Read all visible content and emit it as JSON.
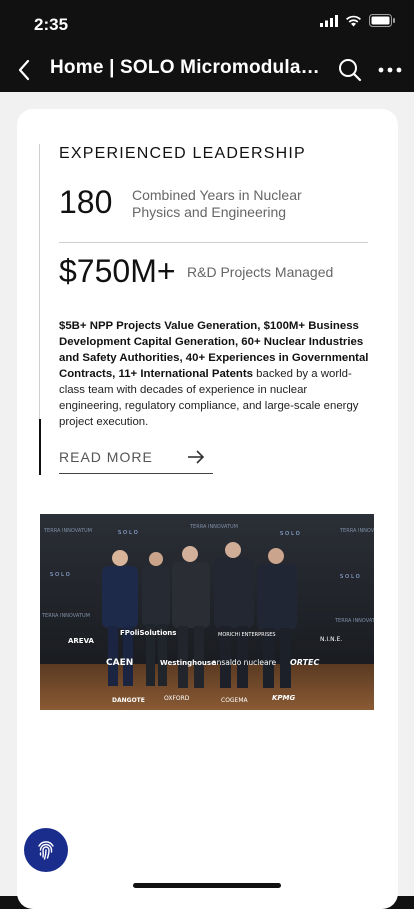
{
  "status_bar": {
    "time": "2:35",
    "icons": [
      "cellular-signal-icon",
      "wifi-icon",
      "battery-icon"
    ]
  },
  "browser": {
    "title": "Home | SOLO Micromodular...",
    "icons": [
      "back-icon",
      "search-icon",
      "more-icon"
    ]
  },
  "section": {
    "heading": "EXPERIENCED LEADERSHIP",
    "stats": [
      {
        "value": "180",
        "label": "Combined Years in Nuclear Physics and Engineering"
      },
      {
        "value": "$750M+",
        "label": "R&D Projects Managed"
      }
    ],
    "body_bold": "$5B+ NPP Projects Value Generation, $100M+ Business Development Capital Generation, 60+ Nuclear Industries and Safety Authorities, 40+ Experiences in Governmental Contracts, 11+ International Patents",
    "body_regular": " backed by a world-class team with decades of experience in nuclear engineering, regulatory compliance, and large-scale energy project execution.",
    "cta_label": "READ MORE"
  },
  "photo": {
    "backdrop_text": [
      "TERRA INNOVATUM",
      "SOLO"
    ],
    "logos": [
      "AREVA",
      "FPoliSolutions",
      "MORICHI ENTERPRISES",
      "N.I.N.E.",
      "CAEN",
      "Westinghouse",
      "ansaldo nucleare",
      "ORTEC",
      "DANGOTE",
      "OXFORD",
      "COGEMA",
      "KPMG"
    ]
  },
  "colors": {
    "browser_bar": "#111111",
    "page_bg": "#f1f1f1",
    "card_bg": "#ffffff",
    "fab": "#1b2d8c"
  }
}
